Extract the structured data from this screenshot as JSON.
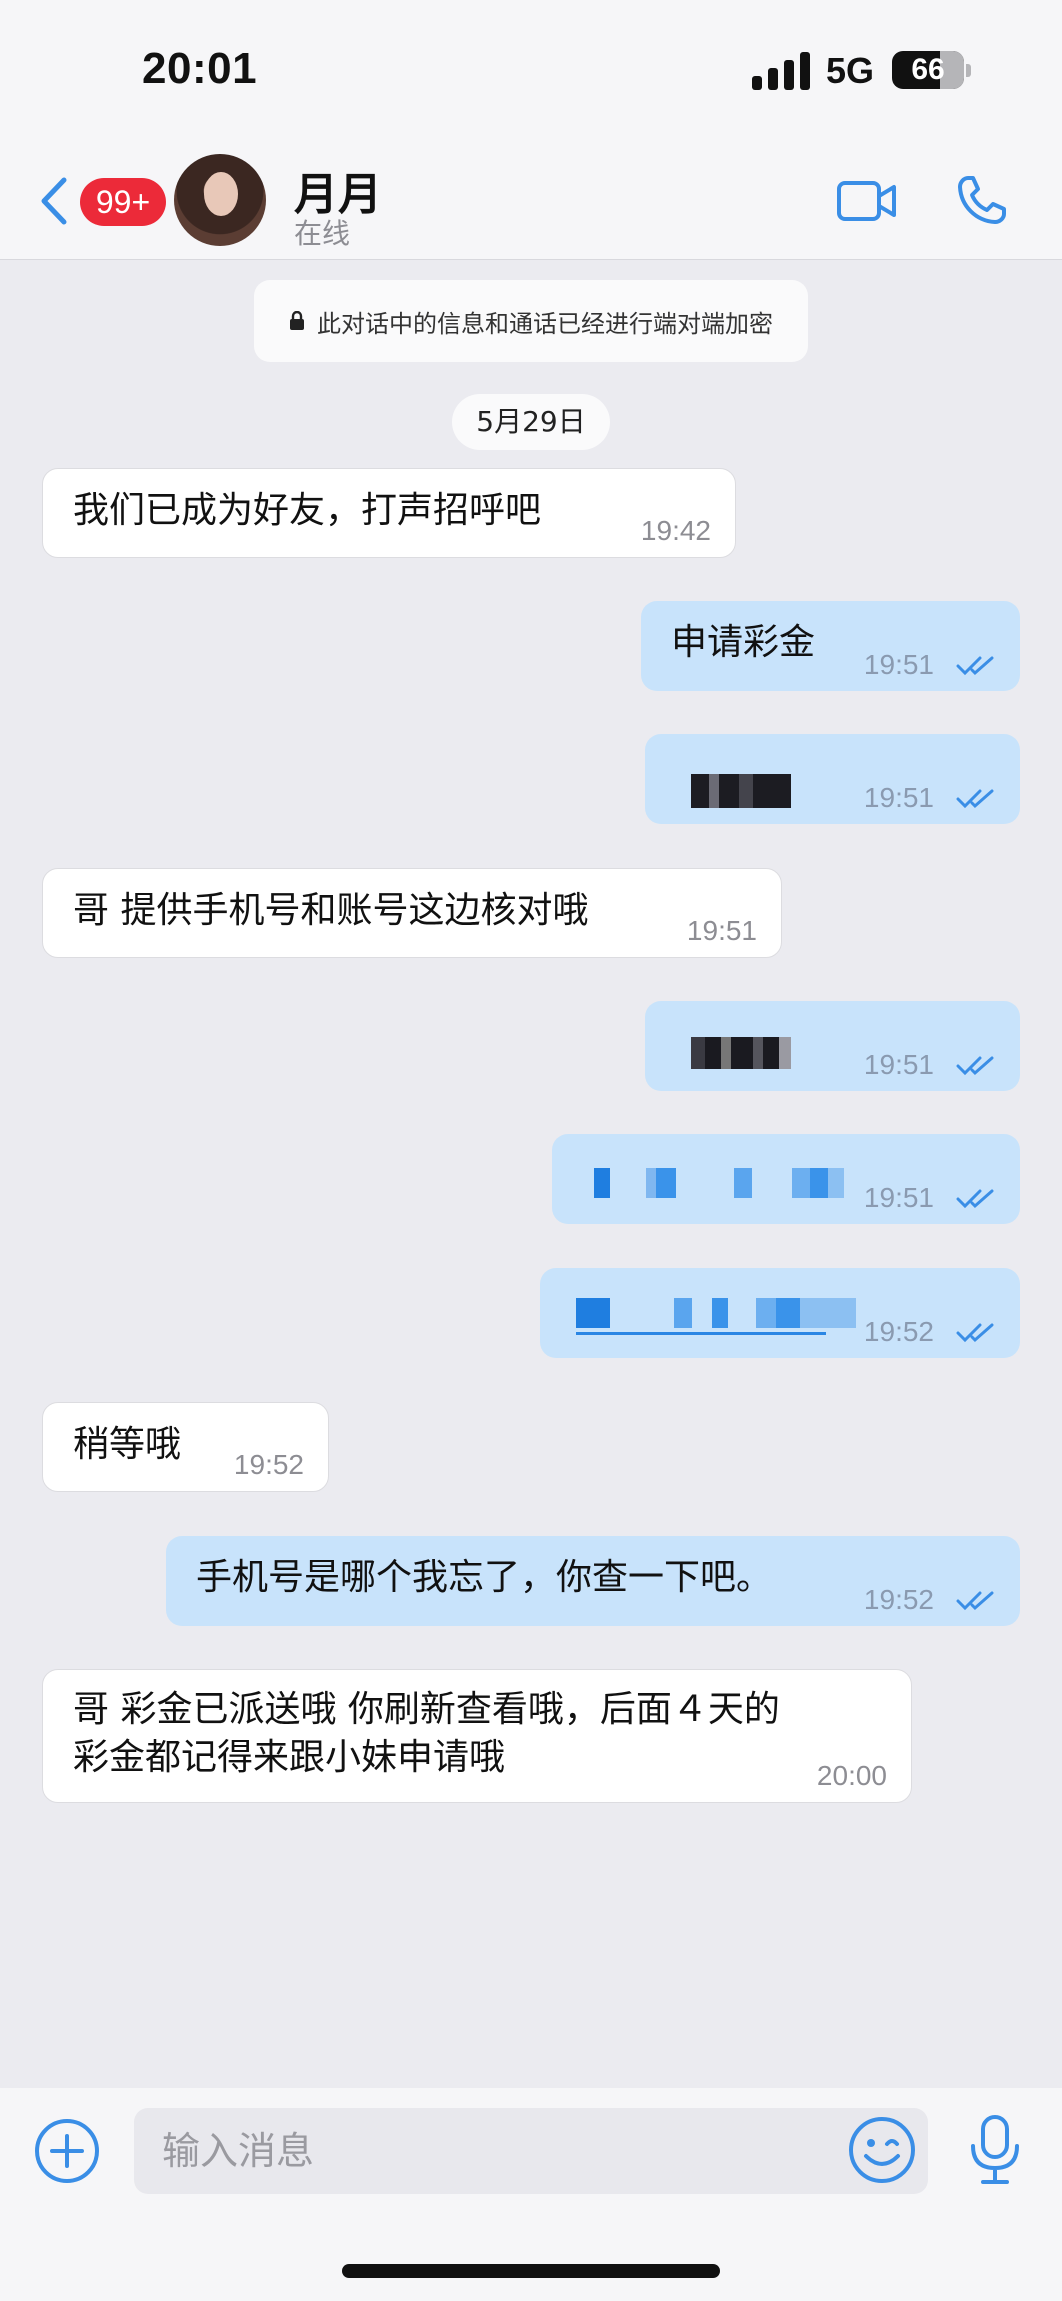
{
  "status_bar": {
    "time": "20:01",
    "network": "5G",
    "battery": "66"
  },
  "header": {
    "back_icon": "chevron-left-icon",
    "unread_badge": "99+",
    "contact_name": "月月",
    "contact_status": "在线",
    "video_icon": "video-camera-icon",
    "call_icon": "phone-icon"
  },
  "chat": {
    "encryption_note": "此对话中的信息和通话已经进行端对端加密",
    "date": "5月29日",
    "messages": [
      {
        "dir": "in",
        "text": "我们已成为好友，打声招呼吧",
        "time": "19:42"
      },
      {
        "dir": "out",
        "text": "申请彩金",
        "time": "19:51",
        "read": true
      },
      {
        "dir": "out",
        "text": "",
        "time": "19:51",
        "read": true,
        "redacted": true
      },
      {
        "dir": "in",
        "text": "哥 提供手机号和账号这边核对哦",
        "time": "19:51"
      },
      {
        "dir": "out",
        "text": "",
        "time": "19:51",
        "read": true,
        "redacted": true
      },
      {
        "dir": "out",
        "text": "",
        "time": "19:51",
        "read": true,
        "redacted": true
      },
      {
        "dir": "out",
        "text": "",
        "time": "19:52",
        "read": true,
        "redacted": true
      },
      {
        "dir": "in",
        "text": "稍等哦",
        "time": "19:52"
      },
      {
        "dir": "out",
        "text": "手机号是哪个我忘了，你查一下吧。",
        "time": "19:52",
        "read": true
      },
      {
        "dir": "in",
        "text_line1": "哥 彩金已派送哦 你刷新查看哦，后面４天的",
        "text_line2": "彩金都记得来跟小妹申请哦",
        "time": "20:00"
      }
    ]
  },
  "input": {
    "placeholder": "输入消息",
    "add_icon": "plus-circle-icon",
    "emoji_icon": "emoji-icon",
    "mic_icon": "microphone-icon"
  },
  "colors": {
    "accent": "#3a8ee6",
    "badge": "#ec2a39",
    "outgoing_bubble": "#c8e3fb",
    "incoming_bubble": "#ffffff",
    "background": "#ebebf0"
  }
}
